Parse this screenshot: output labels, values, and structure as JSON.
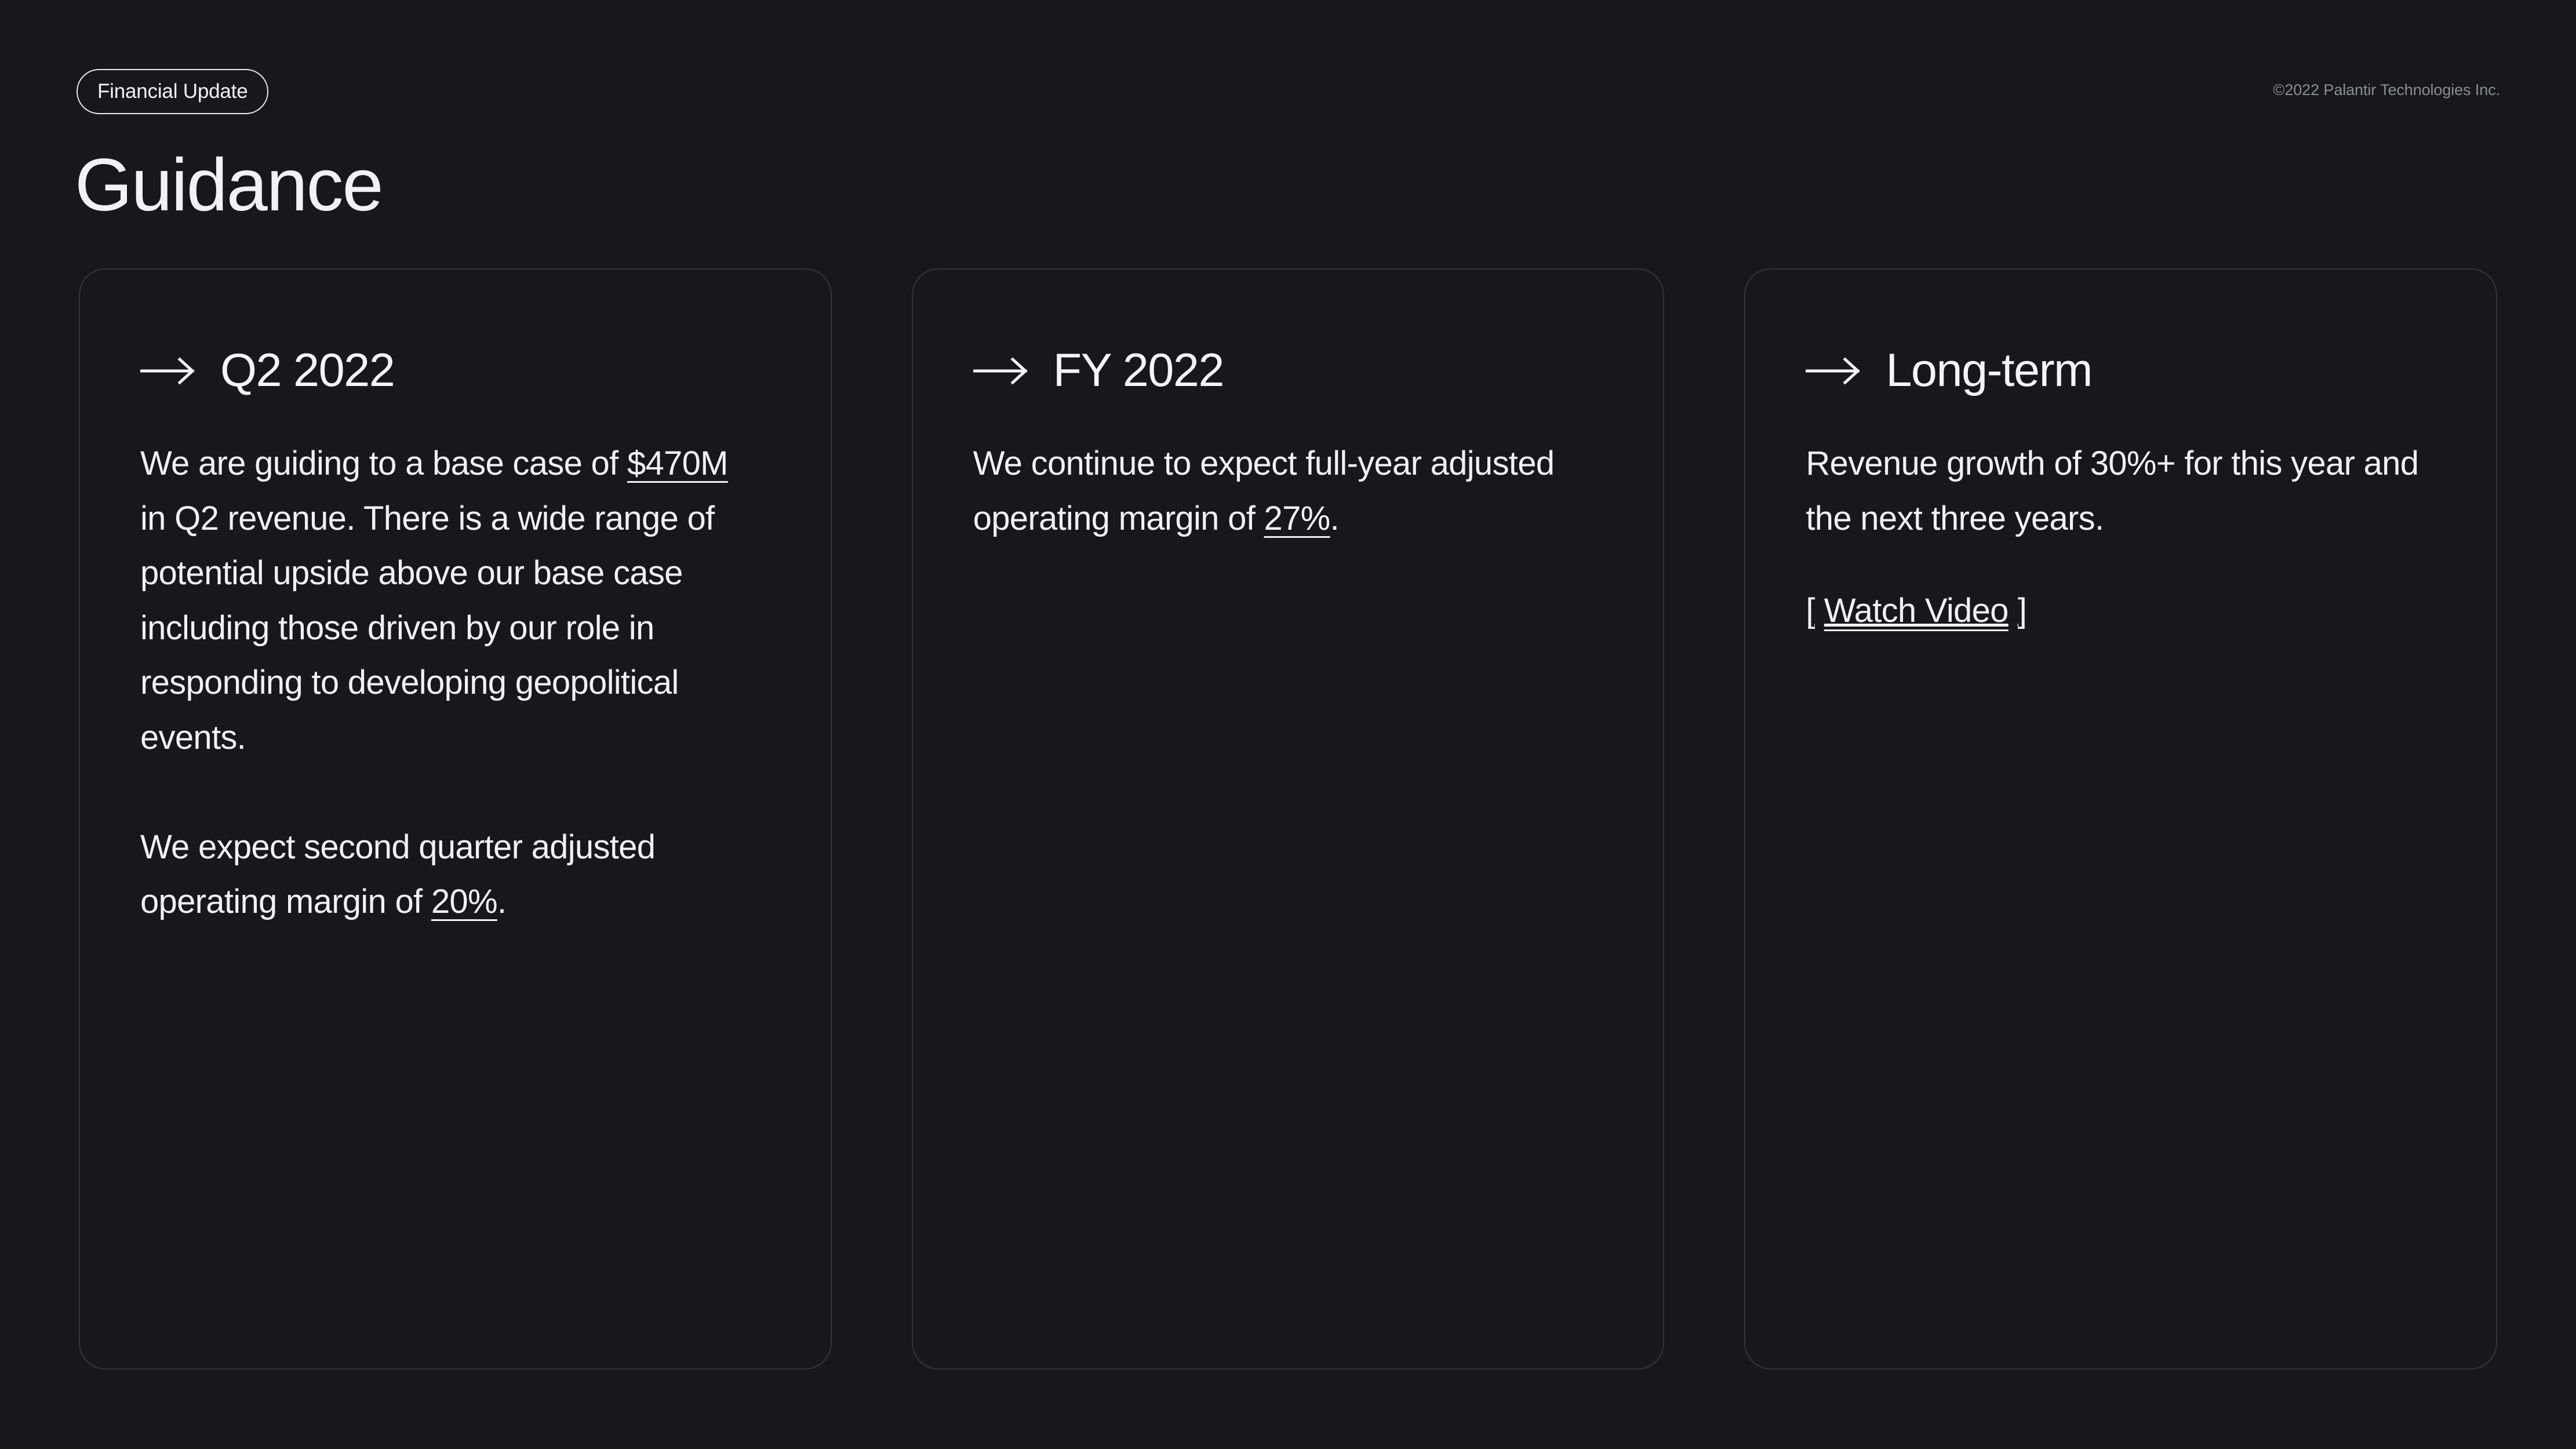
{
  "header": {
    "badge_label": "Financial Update",
    "copyright": "©2022 Palantir Technologies Inc.",
    "title": "Guidance"
  },
  "cards": [
    {
      "arrow_icon": "arrow-right-icon",
      "title": "Q2 2022",
      "paragraph1_a": "We are guiding to a base case of ",
      "paragraph1_highlight": "$470M",
      "paragraph1_b": " in Q2 revenue. There is a wide range of potential upside above our base case including those driven by our role in responding to developing geopolitical events.",
      "paragraph2_a": "We expect second quarter adjusted operating margin of ",
      "paragraph2_highlight": "20%",
      "paragraph2_b": "."
    },
    {
      "arrow_icon": "arrow-right-icon",
      "title": "FY 2022",
      "paragraph1_a": "We continue to expect full-year adjusted operating margin of ",
      "paragraph1_highlight": "27%",
      "paragraph1_b": "."
    },
    {
      "arrow_icon": "arrow-right-icon",
      "title": "Long-term",
      "paragraph1_a": "Revenue growth of 30%+ for this year and the next three years.",
      "link": {
        "bracket_open": "[",
        "label": "Watch Video",
        "bracket_close": "]"
      }
    }
  ],
  "colors": {
    "background": "#16181C",
    "card_border": "#32353B",
    "text_primary": "#F1F2F3",
    "text_muted": "#8A8D93"
  }
}
